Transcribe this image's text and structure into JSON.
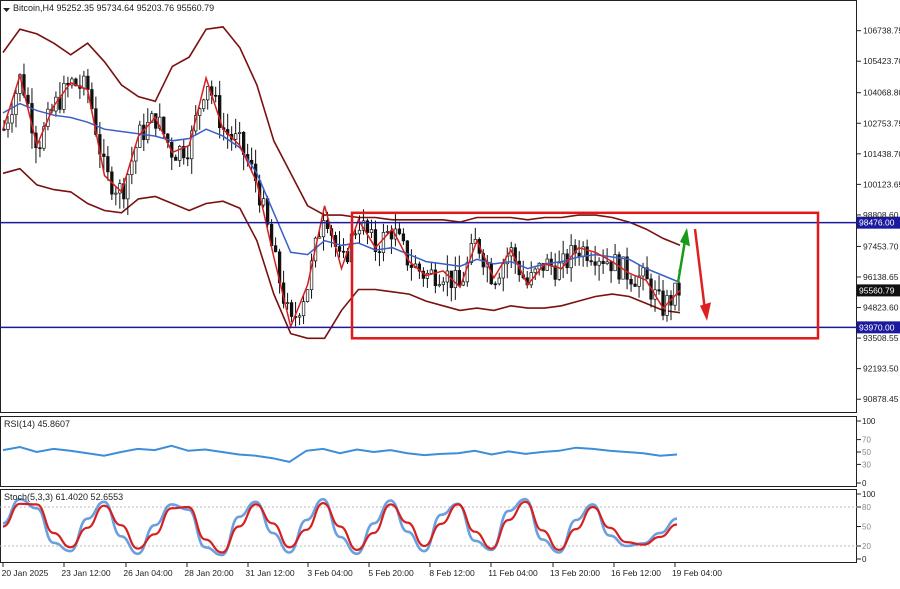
{
  "chart_data": [
    {
      "type": "candlestick",
      "title": "Bitcoin,H4",
      "ohlc_readout": [
        "95252.35",
        "95734.64",
        "95203.76",
        "95560.79"
      ],
      "yticks": [
        "106738.75",
        "105423.70",
        "104068.80",
        "102753.75",
        "101438.70",
        "100123.65",
        "98808.60",
        "97453.70",
        "96138.65",
        "94823.60",
        "93508.55",
        "92193.50",
        "90878.45"
      ],
      "tick_values": [
        106738.75,
        105423.7,
        104068.8,
        102753.75,
        101438.7,
        100123.65,
        98808.6,
        97453.7,
        96138.65,
        94823.6,
        93508.55,
        92193.5,
        90878.45
      ],
      "ylim": [
        90500,
        107800
      ],
      "hlines": [
        {
          "value": 98476.0,
          "label": "98476.00"
        },
        {
          "value": 93970.0,
          "label": "93970.00"
        }
      ],
      "current_price": {
        "value": 95560.79,
        "label": "95560.79"
      },
      "range_box": {
        "from": "5 Feb",
        "to": "19 Feb",
        "top": 98900,
        "bottom": 93500
      },
      "close_path": [
        102500,
        104800,
        101800,
        103500,
        104500,
        104200,
        100500,
        99800,
        102200,
        103000,
        101500,
        101800,
        104700,
        102500,
        101800,
        100200,
        97000,
        94000,
        95800,
        99200,
        96500,
        98600,
        97400,
        98200,
        96800,
        96200,
        96400,
        95700,
        97700,
        96100,
        97300,
        95800,
        96700,
        96500,
        97400,
        97200,
        96800,
        96300,
        96000,
        94800,
        95560
      ],
      "ma_path": [
        103200,
        103600,
        103300,
        103100,
        103000,
        102800,
        102500,
        102400,
        102300,
        102200,
        102000,
        102100,
        102500,
        102200,
        101700,
        100600,
        98900,
        97200,
        97100,
        97700,
        97500,
        97600,
        97300,
        97400,
        97100,
        96800,
        96700,
        96600,
        96900,
        96700,
        96800,
        96500,
        96700,
        96800,
        97000,
        97100,
        97000,
        96900,
        96500,
        96200,
        95900
      ],
      "bb_upper": [
        105800,
        106800,
        106600,
        106200,
        105700,
        106200,
        105400,
        104400,
        103900,
        103700,
        105200,
        105600,
        106800,
        106900,
        106000,
        104400,
        102000,
        100600,
        99200,
        98800,
        98800,
        98700,
        98700,
        98600,
        98600,
        98600,
        98600,
        98500,
        98700,
        98700,
        98700,
        98600,
        98700,
        98700,
        98800,
        98800,
        98700,
        98500,
        98200,
        97800,
        97500
      ],
      "bb_lower": [
        100600,
        100800,
        100100,
        99900,
        99800,
        99300,
        99000,
        98900,
        99500,
        99600,
        99300,
        99000,
        99300,
        99400,
        99100,
        97700,
        95400,
        93700,
        93500,
        93500,
        94700,
        95600,
        95600,
        95500,
        95400,
        95100,
        94900,
        94700,
        94800,
        94700,
        94900,
        94800,
        94800,
        94900,
        95100,
        95300,
        95400,
        95300,
        95000,
        94700,
        94600
      ],
      "arrows": [
        {
          "direction": "up",
          "color": "#1a9a1a"
        },
        {
          "direction": "down",
          "color": "#e02020"
        }
      ],
      "xtick_labels": [
        "20 Jan 2025",
        "23 Jan 12:00",
        "26 Jan 04:00",
        "28 Jan 20:00",
        "31 Jan 12:00",
        "3 Feb 04:00",
        "5 Feb 20:00",
        "8 Feb 12:00",
        "11 Feb 04:00",
        "13 Feb 20:00",
        "16 Feb 12:00",
        "19 Feb 04:00"
      ]
    },
    {
      "type": "line",
      "title": "RSI(14) 45.8607",
      "yticks": [
        "100",
        "70",
        "50",
        "30",
        "0"
      ],
      "ylim": [
        0,
        100
      ],
      "values": [
        53,
        58,
        50,
        55,
        52,
        48,
        44,
        50,
        55,
        53,
        60,
        52,
        54,
        50,
        46,
        44,
        40,
        34,
        52,
        55,
        48,
        54,
        50,
        53,
        48,
        45,
        47,
        48,
        52,
        46,
        51,
        47,
        50,
        52,
        57,
        55,
        52,
        50,
        48,
        44,
        46
      ]
    },
    {
      "type": "line",
      "title": "Stoch(5,3,3) 61.4020 52.6553",
      "yticks": [
        "100",
        "80",
        "50",
        "20",
        "0"
      ],
      "ylim": [
        0,
        100
      ],
      "series": [
        {
          "values": [
            55,
            92,
            78,
            25,
            12,
            62,
            88,
            35,
            8,
            52,
            84,
            76,
            18,
            6,
            65,
            88,
            40,
            10,
            60,
            92,
            34,
            8,
            55,
            90,
            42,
            12,
            68,
            85,
            28,
            14,
            74,
            92,
            30,
            10,
            60,
            84,
            36,
            20,
            24,
            40,
            62
          ]
        },
        {
          "values": [
            50,
            85,
            84,
            40,
            18,
            48,
            82,
            52,
            16,
            38,
            78,
            80,
            30,
            10,
            50,
            84,
            55,
            18,
            45,
            86,
            50,
            14,
            40,
            84,
            56,
            20,
            54,
            84,
            42,
            16,
            60,
            88,
            44,
            14,
            46,
            80,
            48,
            26,
            22,
            34,
            53
          ]
        }
      ]
    }
  ]
}
